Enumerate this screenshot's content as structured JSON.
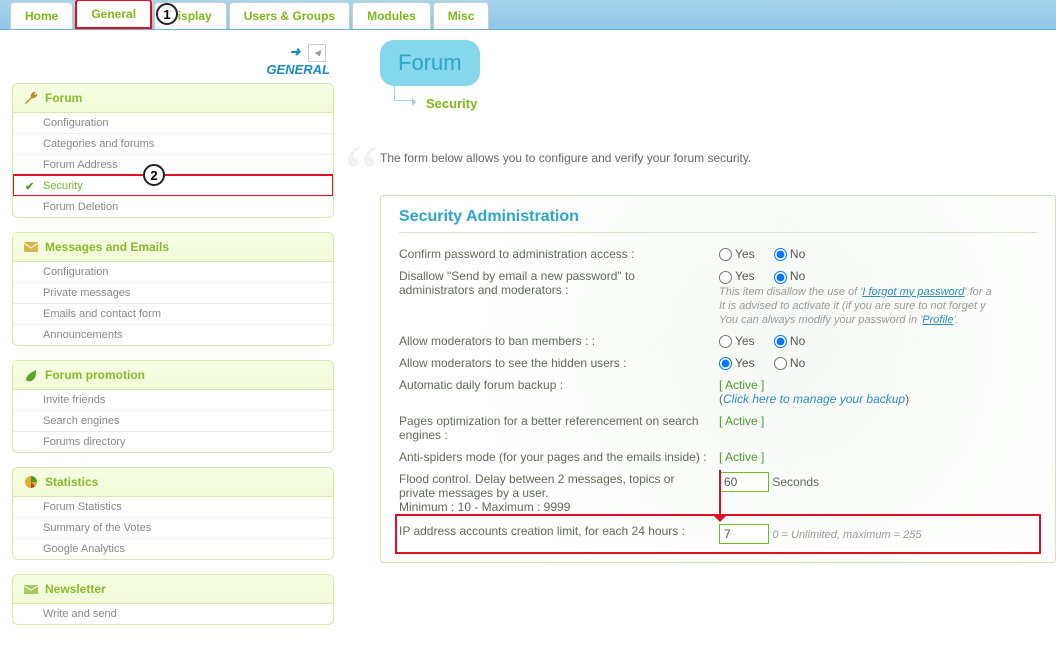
{
  "tabs": [
    "Home",
    "General",
    "Display",
    "Users & Groups",
    "Modules",
    "Misc"
  ],
  "callouts": {
    "tab": "1",
    "sidebar": "2"
  },
  "sidebarTitle": "GENERAL",
  "panels": [
    {
      "title": "Forum",
      "icon": "wrench",
      "color": "#c08a20",
      "items": [
        "Configuration",
        "Categories and forums",
        "Forum Address",
        "Security",
        "Forum Deletion"
      ],
      "selected": 3
    },
    {
      "title": "Messages and Emails",
      "icon": "mail",
      "color": "#b0901a",
      "items": [
        "Configuration",
        "Private messages",
        "Emails and contact form",
        "Announcements"
      ]
    },
    {
      "title": "Forum promotion",
      "icon": "leaf",
      "color": "#5fa32a",
      "items": [
        "Invite friends",
        "Search engines",
        "Forums directory"
      ]
    },
    {
      "title": "Statistics",
      "icon": "pie",
      "color": "#c4a020",
      "items": [
        "Forum Statistics",
        "Summary of the Votes",
        "Google Analytics"
      ]
    },
    {
      "title": "Newsletter",
      "icon": "envelope",
      "color": "#8ab92d",
      "items": [
        "Write and send"
      ]
    }
  ],
  "breadcrumb": {
    "root": "Forum",
    "sub": "Security"
  },
  "intro": "The form below allows you to configure and verify your forum security.",
  "sectionTitle": "Security Administration",
  "rows": {
    "confirmPwd": {
      "label": "Confirm password to administration access :",
      "yes": "Yes",
      "no": "No",
      "value": "no"
    },
    "disallowSend": {
      "label": "Disallow \"Send by email a new password\" to administrators and moderators :",
      "yes": "Yes",
      "no": "No",
      "value": "no",
      "hint_pre": "This item disallow the use of '",
      "hint_link1": "I forgot my password",
      "hint_mid": "' for a\nIt is advised to activate it (if you are sure to not forget y\nYou can always modify your password in '",
      "hint_link2": "Profile",
      "hint_post": "'."
    },
    "allowBan": {
      "label": "Allow moderators to ban members : :",
      "yes": "Yes",
      "no": "No",
      "value": "no"
    },
    "allowHidden": {
      "label": "Allow moderators to see the hidden users :",
      "yes": "Yes",
      "no": "No",
      "value": "yes"
    },
    "backup": {
      "label": "Automatic daily forum backup :",
      "status": "[ Active ]",
      "link": "Click here to manage your backup"
    },
    "seo": {
      "label": "Pages optimization for a better referencement on search engines :",
      "status": "[ Active ]"
    },
    "antispider": {
      "label": "Anti-spiders mode (for your pages and the emails inside) :",
      "status": "[ Active ]"
    },
    "flood": {
      "label": "Flood control. Delay between 2 messages, topics or private messages by a user.",
      "sub": "Minimum : 10 - Maximum : 9999",
      "value": "60",
      "unit": "Seconds"
    },
    "iplimit": {
      "label": "IP address accounts creation limit, for each 24 hours :",
      "value": "7",
      "hint": "0 = Unlimited, maximum = 255"
    }
  }
}
